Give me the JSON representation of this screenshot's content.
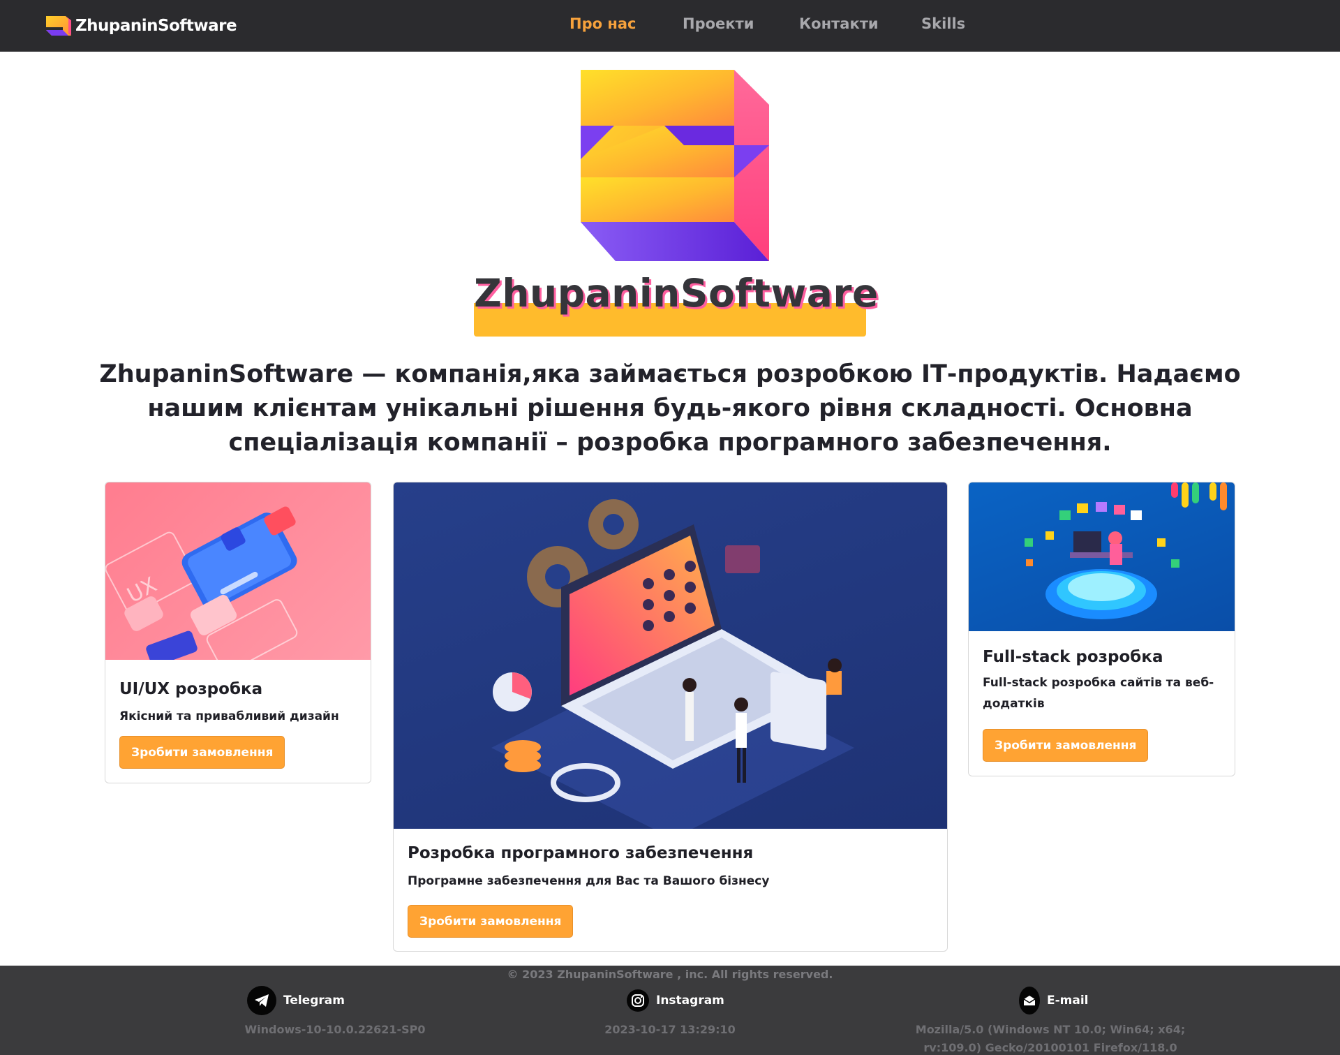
{
  "navbar": {
    "brand_name": "ZhupaninSoftware",
    "links": [
      {
        "label": "Про нас",
        "active": true
      },
      {
        "label": "Проекти",
        "active": false
      },
      {
        "label": "Контакти",
        "active": false
      },
      {
        "label": "Skills",
        "active": false
      }
    ]
  },
  "hero": {
    "logo_word": "ZhupaninSoftware",
    "intro": "ZhupaninSoftware — компанія,яка займається розробкою ІТ-продуктів. Надаємо нашим клієнтам унікальні рішення будь-якого рівня складності. Основна спеціалізація компанії – розробка програмного забезпечення."
  },
  "cards": [
    {
      "title": "UI/UX розробка",
      "text": "Якісний та привабливий дизайн",
      "button": "Зробити замовлення",
      "image_label": "UX"
    },
    {
      "title": "Розробка програмного забезпечення",
      "text": "Програмне забезпечення для Вас та Вашого бізнесу",
      "button": "Зробити замовлення"
    },
    {
      "title": "Full-stack розробка",
      "text": "Full-stack розробка сайтів та веб-додатків",
      "button": "Зробити замовлення"
    }
  ],
  "footer": {
    "copyright": "© 2023 ZhupaninSoftware , inc. All rights reserved.",
    "social": [
      {
        "label": "Telegram",
        "icon": "telegram-icon"
      },
      {
        "label": "Instagram",
        "icon": "instagram-icon"
      },
      {
        "label": "E-mail",
        "icon": "email-icon"
      }
    ],
    "platform": "Windows-10-10.0.22621-SP0",
    "datetime": "2023-10-17 13:29:10",
    "user_agent": "Mozilla/5.0 (Windows NT 10.0; Win64; x64; rv:109.0) Gecko/20100101 Firefox/118.0"
  },
  "colors": {
    "navbar_bg": "#2b2b2e",
    "accent": "#f7a23c",
    "button": "#ffa333",
    "footer_bg": "#3b3b3d"
  }
}
